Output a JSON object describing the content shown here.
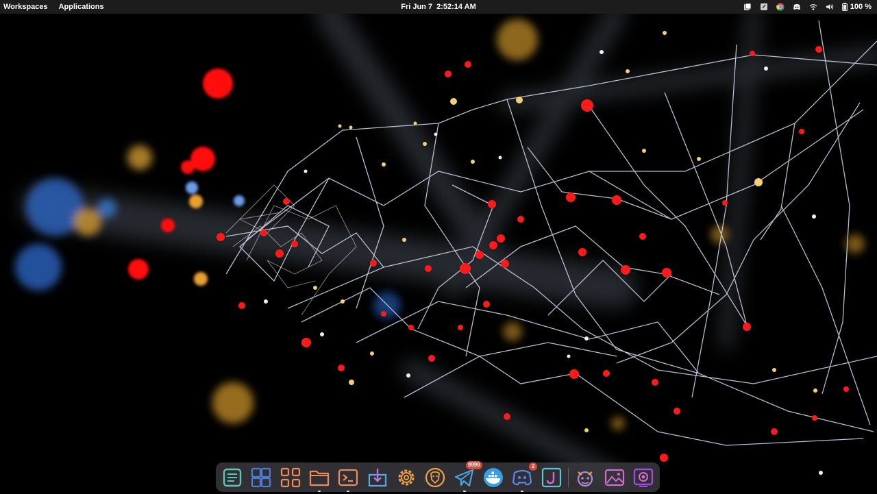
{
  "topbar": {
    "workspaces_label": "Workspaces",
    "applications_label": "Applications",
    "date": "Fri Jun 7",
    "time": "2:52:14 AM",
    "tray_icons": [
      "clipboard-icon",
      "notes-icon",
      "chrome-icon",
      "discord-icon",
      "wifi-icon",
      "volume-icon",
      "battery-icon"
    ],
    "battery_text": "100 %"
  },
  "wallpaper": {
    "description_colors": {
      "background": "#000000",
      "lines": "#d8dcf0",
      "nodes_red": "#ff1a1a",
      "nodes_gold": "#f0b43c",
      "nodes_blue": "#3a7bd5"
    }
  },
  "dock": {
    "apps": [
      {
        "name": "notes-app-icon",
        "color": "#5cc6b8"
      },
      {
        "name": "workspace-grid-icon",
        "color": "#4a7dd8"
      },
      {
        "name": "app-grid-icon",
        "color": "#f08a5d"
      },
      {
        "name": "files-icon",
        "color": "#f08a5d"
      },
      {
        "name": "terminal-icon",
        "color": "#f08a5d"
      },
      {
        "name": "software-center-icon",
        "color": "#5aa9e6"
      },
      {
        "name": "settings-icon",
        "color": "#f0a048"
      },
      {
        "name": "brave-browser-icon",
        "color": "#f0a048"
      },
      {
        "name": "telegram-icon",
        "color": "#4aa3e0",
        "badge": "9999"
      },
      {
        "name": "docker-icon",
        "color": "#3b9de6"
      },
      {
        "name": "discord-app-icon",
        "color": "#5a87f0",
        "badge": "2"
      },
      {
        "name": "jetbrains-icon",
        "color": "#5cc6d8"
      },
      {
        "name": "gimp-icon",
        "color": "#b08ad8"
      },
      {
        "name": "image-viewer-icon",
        "color": "#d86ad8"
      },
      {
        "name": "screen-recorder-icon",
        "color": "#a04ad8"
      }
    ]
  }
}
